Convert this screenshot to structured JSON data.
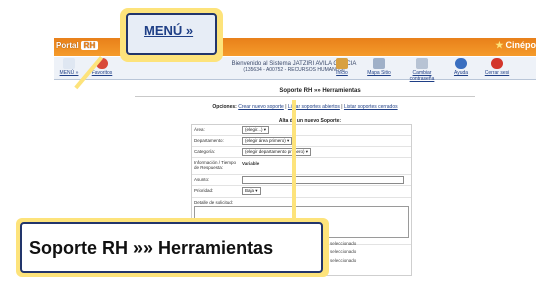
{
  "header": {
    "portal": "Portal",
    "rh": "RH",
    "brand": "Cinépo"
  },
  "nav": {
    "menu_label": "MENÚ »",
    "favoritos": "Favoritos",
    "welcome_line1": "Bienvenido al Sistema JATZIRI AVILA GARCIA",
    "welcome_line2": "(135634 - A00752 - RECURSOS HUMANOS)",
    "inicio": "Inicio",
    "mapa": "Mapa Sitio",
    "cambiar": "Cambiar contraseña",
    "ayuda": "Ayuda",
    "cerrar": "Cerrar sesi"
  },
  "page": {
    "title": "Soporte RH »» Herramientas",
    "options_prefix": "Opciones:",
    "opt_create": "Crear nuevo soporte",
    "sep": " | ",
    "opt_open": "Listar soportes abiertos",
    "opt_closed": "Listar soportes cerrados",
    "form_title": "Alta de un nuevo Soporte:"
  },
  "form": {
    "area_label": "Área:",
    "area_value": "(elegir...)",
    "dept_label": "Departamento:",
    "dept_value": "(elegir área primero)",
    "cat_label": "Categoría:",
    "cat_value": "(elegir departamento primero)",
    "info_label": "Información / Tiempo de Respuesta:",
    "info_value": "Variable",
    "asunto_label": "Asunto:",
    "prioridad_label": "Prioridad:",
    "prioridad_value": "Baja",
    "detalle_label": "Detalle de solicitud:",
    "sel_note_1": "seleccionado",
    "sel_note_2": "seleccionado",
    "sel_note_3": "seleccionado"
  },
  "callouts": {
    "menu": "MENÚ »",
    "title": "Soporte RH »» Herramientas"
  }
}
